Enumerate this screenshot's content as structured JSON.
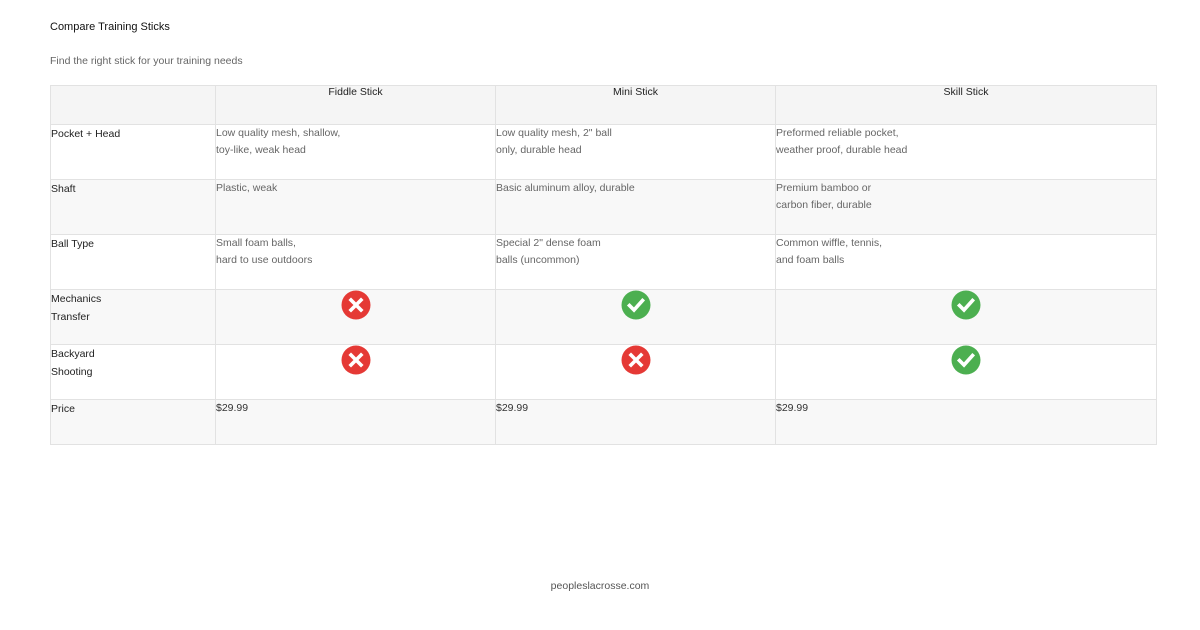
{
  "title": "Compare Training Sticks",
  "subtitle": "Find the right stick for your training needs",
  "table": {
    "columns": [
      "",
      "Fiddle Stick",
      "Mini Stick",
      "Skill Stick"
    ],
    "rows": {
      "pocket": {
        "label": "Pocket + Head",
        "values": [
          [
            "Low quality mesh, shallow,",
            "toy-like, weak head"
          ],
          [
            "Low quality mesh, 2\" ball",
            "only, durable head"
          ],
          [
            "Preformed reliable pocket,",
            "weather proof, durable head"
          ]
        ]
      },
      "shaft": {
        "label": "Shaft",
        "values": [
          [
            "Plastic, weak",
            ""
          ],
          [
            "Basic aluminum alloy, durable",
            ""
          ],
          [
            "Premium bamboo or",
            "carbon fiber, durable"
          ]
        ]
      },
      "ball": {
        "label": "Ball Type",
        "values": [
          [
            "Small foam balls,",
            "hard to use outdoors"
          ],
          [
            "Special 2\" dense foam",
            "balls (uncommon)"
          ],
          [
            "Common wiffle, tennis,",
            "and foam balls"
          ]
        ]
      },
      "mechanics": {
        "label_lines": [
          "Mechanics",
          "Transfer"
        ],
        "values": [
          "no",
          "yes",
          "yes"
        ]
      },
      "backyard": {
        "label_lines": [
          "Backyard",
          "Shooting"
        ],
        "values": [
          "no",
          "no",
          "yes"
        ]
      },
      "price": {
        "label": "Price",
        "values": [
          "$29.99",
          "$29.99",
          "$29.99"
        ]
      }
    }
  },
  "icons": {
    "yes": "check-circle-icon",
    "no": "x-circle-icon",
    "yes_color": "#4caf50",
    "no_color": "#e53935"
  },
  "footer": "peopleslacrosse.com"
}
